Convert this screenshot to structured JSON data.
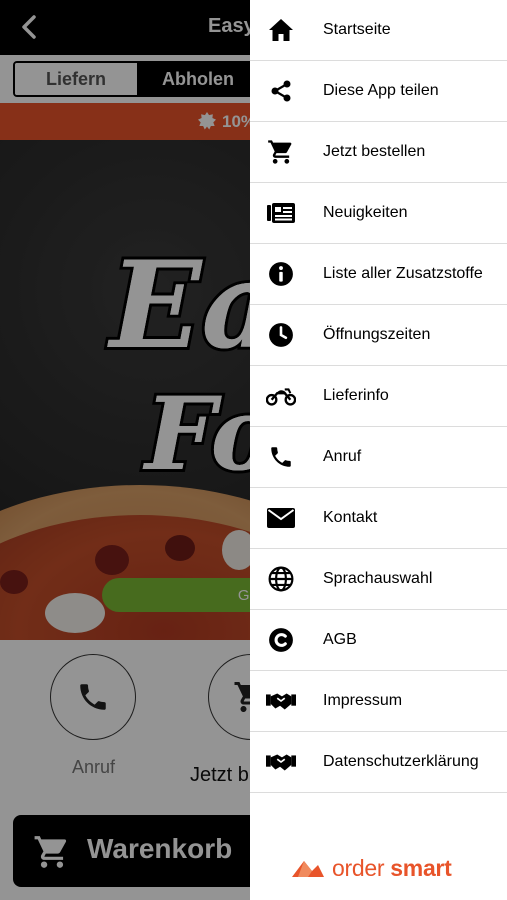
{
  "header": {
    "title": "Easy"
  },
  "order_mode": {
    "tabs": [
      {
        "label": "Liefern"
      },
      {
        "label": "Abholen"
      }
    ]
  },
  "promo": {
    "text": "10%"
  },
  "hero": {
    "logo_line_1": "Ea",
    "logo_line_2": "Fo",
    "cta_label": "Geö"
  },
  "actions": {
    "call_label": "Anruf",
    "order_label": "Jetzt b"
  },
  "cart": {
    "label": "Warenkorb"
  },
  "drawer": {
    "items": [
      {
        "label": "Startseite",
        "icon": "home-icon"
      },
      {
        "label": "Diese App teilen",
        "icon": "share-icon"
      },
      {
        "label": "Jetzt bestellen",
        "icon": "cart-icon"
      },
      {
        "label": "Neuigkeiten",
        "icon": "news-icon"
      },
      {
        "label": "Liste aller Zusatzstoffe",
        "icon": "info-icon"
      },
      {
        "label": "Öffnungszeiten",
        "icon": "clock-icon"
      },
      {
        "label": "Lieferinfo",
        "icon": "motorbike-icon"
      },
      {
        "label": "Anruf",
        "icon": "phone-icon"
      },
      {
        "label": "Kontakt",
        "icon": "envelope-icon"
      },
      {
        "label": "Sprachauswahl",
        "icon": "globe-icon"
      },
      {
        "label": "AGB",
        "icon": "copyright-icon"
      },
      {
        "label": "Impressum",
        "icon": "handshake-icon"
      },
      {
        "label": "Datenschutzerklärung",
        "icon": "handshake-icon"
      }
    ],
    "brand": {
      "text_regular": "order ",
      "text_bold": "smart",
      "icon": "ordersmart-logo-icon"
    }
  },
  "colors": {
    "accent": "#e8542a",
    "green": "#7ab834",
    "header": "#000000"
  }
}
